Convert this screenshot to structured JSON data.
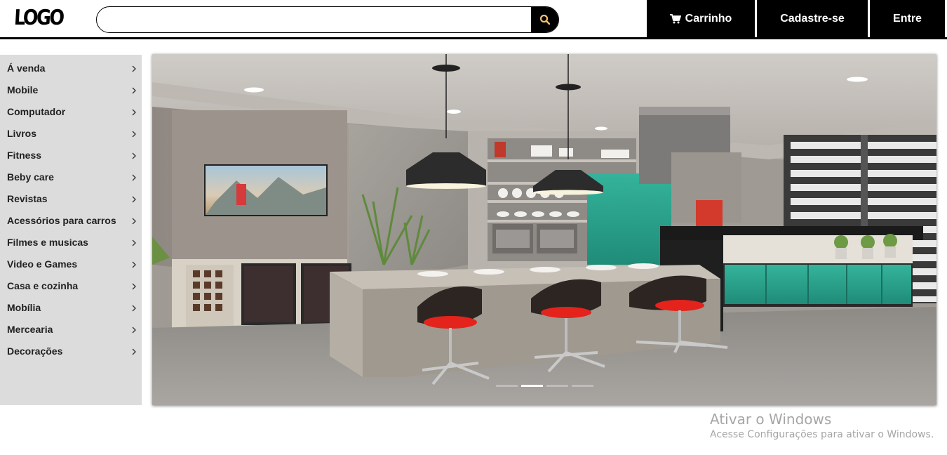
{
  "header": {
    "logo": "LOGO",
    "search": {
      "value": "",
      "placeholder": ""
    },
    "cart_label": "Carrinho",
    "register_label": "Cadastre-se",
    "login_label": "Entre"
  },
  "sidebar": {
    "items": [
      {
        "label": "Á venda"
      },
      {
        "label": "Mobile"
      },
      {
        "label": "Computador"
      },
      {
        "label": "Livros"
      },
      {
        "label": "Fitness"
      },
      {
        "label": "Beby care"
      },
      {
        "label": "Revistas"
      },
      {
        "label": "Acessórios para carros"
      },
      {
        "label": "Filmes e musicas"
      },
      {
        "label": "Video e Games"
      },
      {
        "label": "Casa e cozinha"
      },
      {
        "label": "Mobília"
      },
      {
        "label": "Mercearia"
      },
      {
        "label": "Decorações"
      }
    ]
  },
  "carousel": {
    "slide_count": 4,
    "active_index": 1
  },
  "watermark": {
    "title": "Ativar o Windows",
    "subtitle": "Acesse Configurações para ativar o Windows."
  },
  "icons": {
    "search": "search-icon",
    "cart": "cart-icon",
    "chevron": "chevron-right-icon"
  },
  "colors": {
    "header_button_bg": "#000000",
    "sidebar_bg": "#dcdcdc",
    "accent_teal": "#2aa58f",
    "accent_red": "#e8261c"
  }
}
